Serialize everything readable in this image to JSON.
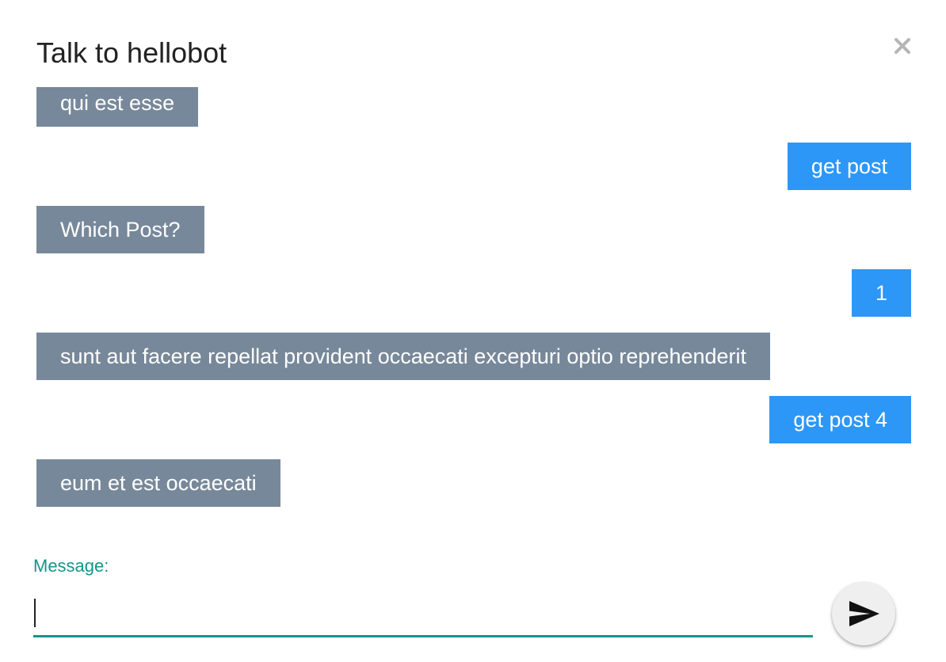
{
  "dialog": {
    "title": "Talk to hellobot",
    "close_icon": "close-icon"
  },
  "chat": {
    "messages": [
      {
        "sender": "bot",
        "text": "qui est esse"
      },
      {
        "sender": "user",
        "text": "get post"
      },
      {
        "sender": "bot",
        "text": "Which Post?"
      },
      {
        "sender": "user",
        "text": "1"
      },
      {
        "sender": "bot",
        "text": "sunt aut facere repellat provident occaecati excepturi optio reprehenderit"
      },
      {
        "sender": "user",
        "text": "get post 4"
      },
      {
        "sender": "bot",
        "text": "eum et est occaecati"
      }
    ]
  },
  "composer": {
    "label": "Message:",
    "value": "",
    "send_icon": "send-icon"
  },
  "colors": {
    "bot_bubble": "#77889a",
    "user_bubble": "#2c97f7",
    "accent": "#12968a"
  }
}
